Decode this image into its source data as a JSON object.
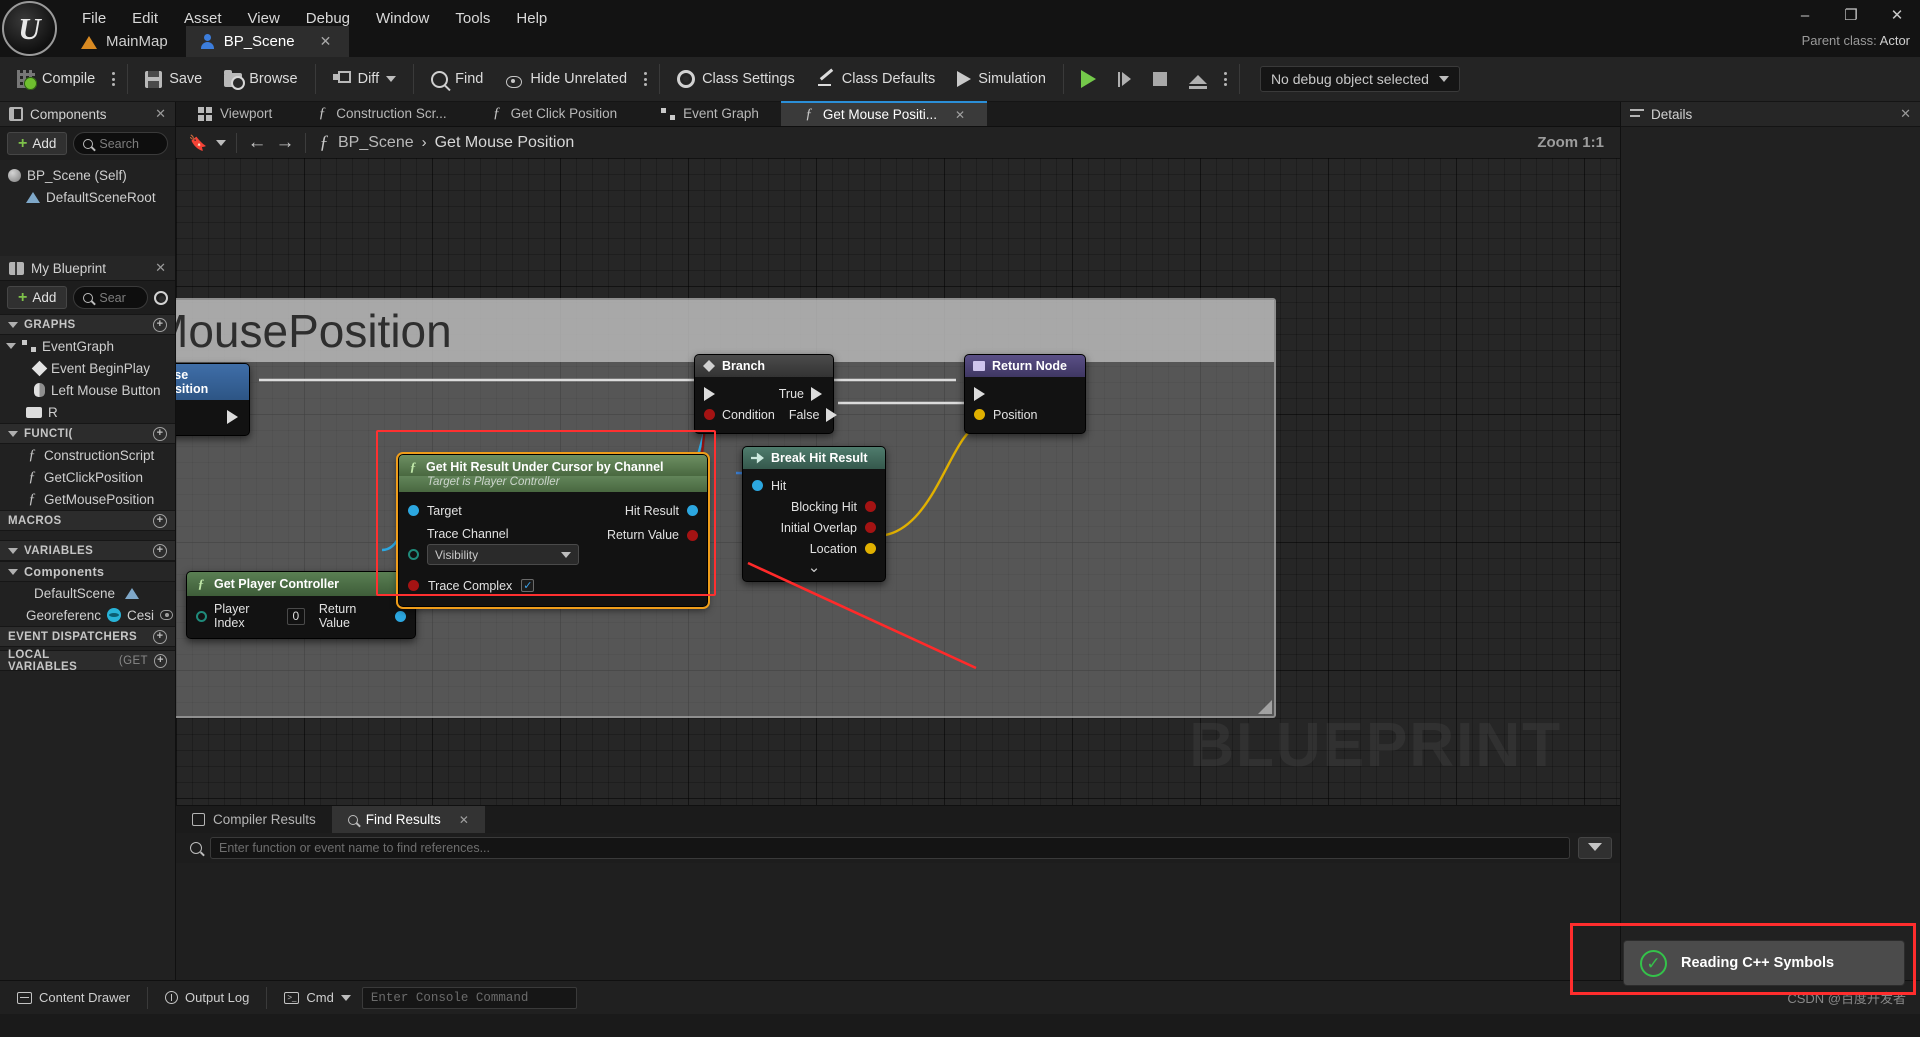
{
  "app": {
    "logo_icon": "unreal-engine-logo",
    "parent_class_label": "Parent class:",
    "parent_class_value": "Actor"
  },
  "menubar": [
    "File",
    "Edit",
    "Asset",
    "View",
    "Debug",
    "Window",
    "Tools",
    "Help"
  ],
  "window_controls": {
    "minimize": "–",
    "maximize": "❐",
    "close": "✕"
  },
  "document_tabs": [
    {
      "label": "MainMap",
      "icon": "map-icon",
      "active": false,
      "closable": false
    },
    {
      "label": "BP_Scene",
      "icon": "blueprint-icon",
      "active": true,
      "closable": true
    }
  ],
  "toolbar": {
    "compile": "Compile",
    "save": "Save",
    "browse": "Browse",
    "diff": "Diff",
    "find": "Find",
    "hide_unrelated": "Hide Unrelated",
    "class_settings": "Class Settings",
    "class_defaults": "Class Defaults",
    "simulation": "Simulation",
    "debug_object": "No debug object selected"
  },
  "components_panel": {
    "title": "Components",
    "add_label": "Add",
    "search_placeholder": "Search",
    "items": [
      {
        "label": "BP_Scene (Self)",
        "icon": "sphere-icon",
        "indent": 0
      },
      {
        "label": "DefaultSceneRoot",
        "icon": "scene-root-icon",
        "indent": 1
      }
    ]
  },
  "myblueprint_panel": {
    "title": "My Blueprint",
    "add_label": "Add",
    "search_placeholder": "Sear",
    "sections": [
      {
        "name": "GRAPHS",
        "type": "section",
        "items": [
          {
            "label": "EventGraph",
            "icon": "graph-icon",
            "indent": 0
          },
          {
            "label": "Event BeginPlay",
            "icon": "event-node-icon",
            "indent": 1
          },
          {
            "label": "Left Mouse Button",
            "icon": "mouse-icon",
            "indent": 1
          },
          {
            "label": "R",
            "icon": "keyboard-icon",
            "indent": 1
          }
        ]
      },
      {
        "name": "FUNCTI(",
        "type": "section",
        "items": [
          {
            "label": "ConstructionScript",
            "icon": "function-icon",
            "indent": 1
          },
          {
            "label": "GetClickPosition",
            "icon": "function-icon",
            "indent": 1
          },
          {
            "label": "GetMousePosition",
            "icon": "function-icon",
            "indent": 1
          }
        ]
      },
      {
        "name": "MACROS",
        "type": "section",
        "items": []
      },
      {
        "name": "VARIABLES",
        "type": "section",
        "items": []
      },
      {
        "name": "Components",
        "type": "subsection",
        "items": [
          {
            "label": "DefaultScene",
            "icon": "scene-root-icon",
            "indent": 1
          },
          {
            "label": "Georeferenc",
            "trailing": "Cesi",
            "icon": "cesium-icon",
            "indent": 1
          }
        ]
      },
      {
        "name": "EVENT DISPATCHERS",
        "type": "section",
        "items": []
      },
      {
        "name": "LOCAL VARIABLES",
        "suffix": "(GET",
        "type": "section",
        "items": []
      }
    ]
  },
  "graph_tabs": [
    {
      "label": "Viewport",
      "icon": "viewport-icon",
      "active": false,
      "closable": false
    },
    {
      "label": "Construction Scr...",
      "icon": "function-icon",
      "active": false,
      "closable": false
    },
    {
      "label": "Get Click Position",
      "icon": "function-icon",
      "active": false,
      "closable": false
    },
    {
      "label": "Event Graph",
      "icon": "graph-icon",
      "active": false,
      "closable": false
    },
    {
      "label": "Get Mouse Positi...",
      "icon": "function-icon",
      "active": true,
      "closable": true
    }
  ],
  "breadcrumb": {
    "bookmark_icon": "bookmark-icon",
    "back_icon": "arrow-left-icon",
    "forward_icon": "arrow-right-icon",
    "function_icon": "function-icon",
    "crumbs": [
      "BP_Scene",
      "Get Mouse Position"
    ],
    "separator": "›",
    "zoom_label": "Zoom 1:1"
  },
  "canvas": {
    "watermark": "BLUEPRINT",
    "comment_title": "MousePosition"
  },
  "nodes": {
    "entry": {
      "title": "ouse Position"
    },
    "get_player_controller": {
      "title": "Get Player Controller",
      "icon": "function-icon",
      "inputs": [
        {
          "label": "Player Index",
          "value": "0",
          "pin": "int"
        }
      ],
      "outputs": [
        {
          "label": "Return Value",
          "pin": "object"
        }
      ]
    },
    "get_hit_result": {
      "title": "Get Hit Result Under Cursor by Channel",
      "subtitle": "Target is Player Controller",
      "icon": "function-icon",
      "inputs": [
        {
          "label": "Target",
          "pin": "object"
        },
        {
          "label": "Trace Channel",
          "pin": "enum",
          "value": "Visibility"
        },
        {
          "label": "Trace Complex",
          "pin": "bool",
          "checked": true
        }
      ],
      "outputs": [
        {
          "label": "Hit Result",
          "pin": "struct"
        },
        {
          "label": "Return Value",
          "pin": "bool"
        }
      ]
    },
    "break_hit_result": {
      "title": "Break Hit Result",
      "icon": "break-icon",
      "inputs": [
        {
          "label": "Hit",
          "pin": "struct"
        }
      ],
      "outputs": [
        {
          "label": "Blocking Hit",
          "pin": "bool"
        },
        {
          "label": "Initial Overlap",
          "pin": "bool"
        },
        {
          "label": "Location",
          "pin": "vector"
        }
      ],
      "expander": "⌄"
    },
    "branch": {
      "title": "Branch",
      "icon": "branch-icon",
      "inputs": [
        {
          "label": "Condition",
          "pin": "bool"
        }
      ],
      "outputs": [
        {
          "label": "True",
          "pin": "exec"
        },
        {
          "label": "False",
          "pin": "exec"
        }
      ]
    },
    "return_node": {
      "title": "Return Node",
      "icon": "return-icon",
      "outputs": [
        {
          "label": "Position",
          "pin": "vector"
        }
      ]
    }
  },
  "details_panel": {
    "title": "Details"
  },
  "bottom_panel": {
    "tabs": [
      {
        "label": "Compiler Results",
        "icon": "compiler-icon",
        "active": false,
        "closable": false
      },
      {
        "label": "Find Results",
        "icon": "search-icon",
        "active": true,
        "closable": true
      }
    ],
    "search_placeholder": "Enter function or event name to find references...",
    "filter_icon": "filter-icon"
  },
  "status_bar": {
    "content_drawer": "Content Drawer",
    "output_log": "Output Log",
    "cmd_label": "Cmd",
    "console_placeholder": "Enter Console Command",
    "watermark": "CSDN @百度开发者"
  },
  "toast": {
    "message": "Reading C++ Symbols",
    "icon": "check-circle-icon"
  },
  "colors": {
    "accent_blue": "#2b8fd8",
    "green": "#74c94a",
    "exec_white": "#dcdcdc",
    "pin_blue": "#2ca7e0",
    "pin_red": "#a41313",
    "pin_yellow": "#e0b000",
    "node_select": "#ef9d1a",
    "annotation_red": "#ff2d2d"
  }
}
